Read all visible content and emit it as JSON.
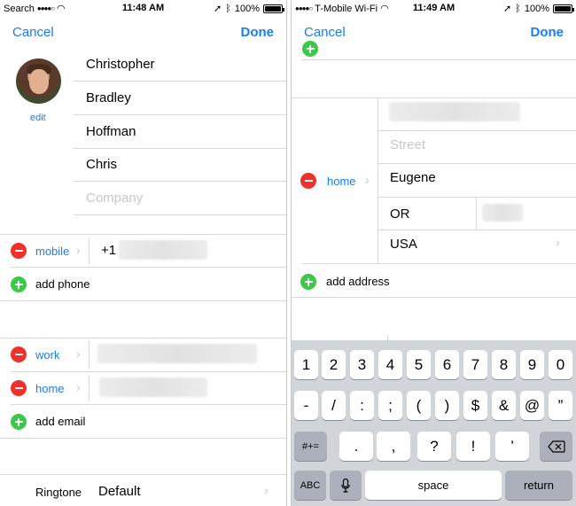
{
  "left_screen": {
    "status": {
      "carrier": "Search",
      "time": "11:48 AM",
      "battery": "100%"
    },
    "nav": {
      "cancel": "Cancel",
      "done": "Done"
    },
    "photo": {
      "edit": "edit"
    },
    "name_fields": [
      "Christopher",
      "Bradley",
      "Hoffman",
      "Chris"
    ],
    "company_placeholder": "Company",
    "phone": {
      "label": "mobile",
      "value": "+1",
      "add": "add phone"
    },
    "emails": [
      {
        "label": "work"
      },
      {
        "label": "home"
      }
    ],
    "add_email": "add email",
    "ringtone": {
      "label": "Ringtone",
      "value": "Default"
    }
  },
  "right_screen": {
    "status": {
      "carrier": "T-Mobile Wi-Fi",
      "time": "11:49 AM",
      "battery": "100%"
    },
    "nav": {
      "cancel": "Cancel",
      "done": "Done"
    },
    "address": {
      "label": "home",
      "street_placeholder": "Street",
      "city": "Eugene",
      "state": "OR",
      "country": "USA"
    },
    "add_address": "add address",
    "keyboard": {
      "row1": [
        "1",
        "2",
        "3",
        "4",
        "5",
        "6",
        "7",
        "8",
        "9",
        "0"
      ],
      "row2": [
        "-",
        "/",
        ":",
        ";",
        "(",
        ")",
        "$",
        "&",
        "@",
        "”"
      ],
      "row3": [
        ".",
        ",",
        "?",
        "!",
        "’"
      ],
      "symbols": "#+=",
      "abc": "ABC",
      "space": "space",
      "return": "return"
    }
  },
  "colors": {
    "accent": "#1a7ef0",
    "delete": "#f0312b",
    "add": "#3cc94a"
  }
}
